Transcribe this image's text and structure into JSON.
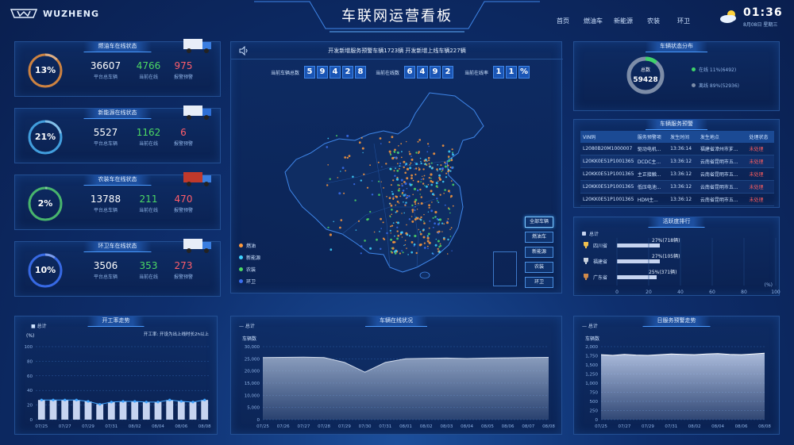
{
  "header": {
    "brand": "WUZHENG",
    "title": "车联网运营看板",
    "nav": [
      {
        "label": "首页",
        "active": true
      },
      {
        "label": "燃油车",
        "active": false
      },
      {
        "label": "新能源",
        "active": false
      },
      {
        "label": "农装",
        "active": false
      },
      {
        "label": "环卫",
        "active": false
      }
    ],
    "time": "01:36",
    "date": "8月08日 星期三",
    "weather_icon": "partly-cloudy-icon"
  },
  "vehicle_cards": [
    {
      "title": "燃油车在线状态",
      "percent": "13%",
      "ring_fraction": 0.13,
      "ring_color": "#e08a3a",
      "total": "36607",
      "total_label": "平台总车辆",
      "online": "4766",
      "online_label": "当前在线",
      "alarm": "975",
      "alarm_label": "报警预警",
      "icon": "truck-icon"
    },
    {
      "title": "新能源在线状态",
      "percent": "21%",
      "ring_fraction": 0.21,
      "ring_color": "#45a8e8",
      "total": "5527",
      "total_label": "平台总车辆",
      "online": "1162",
      "online_label": "当前在线",
      "alarm": "6",
      "alarm_label": "报警预警",
      "icon": "van-icon"
    },
    {
      "title": "农装车在线状态",
      "percent": "2%",
      "ring_fraction": 0.02,
      "ring_color": "#4cc26a",
      "total": "13788",
      "total_label": "平台总车辆",
      "online": "211",
      "online_label": "当前在线",
      "alarm": "470",
      "alarm_label": "报警预警",
      "icon": "tractor-icon"
    },
    {
      "title": "环卫车在线状态",
      "percent": "10%",
      "ring_fraction": 0.1,
      "ring_color": "#3a6ef0",
      "total": "3506",
      "total_label": "平台总车辆",
      "online": "353",
      "online_label": "当前在线",
      "alarm": "273",
      "alarm_label": "报警预警",
      "icon": "sanitation-truck-icon"
    }
  ],
  "center": {
    "notice": "开发新增服务预警车辆1723辆     开发新增上线车辆227辆",
    "kpis": [
      {
        "label": "当前车辆总数",
        "digits": [
          "5",
          "9",
          "4",
          "2",
          "8"
        ]
      },
      {
        "label": "当前在线数",
        "digits": [
          "6",
          "4",
          "9",
          "2"
        ]
      },
      {
        "label": "当前在线率",
        "digits": [
          "1",
          "1",
          "%"
        ]
      }
    ],
    "legend": [
      {
        "label": "燃油",
        "color": "#ff9a3c"
      },
      {
        "label": "新能源",
        "color": "#3fd3ff"
      },
      {
        "label": "农装",
        "color": "#4cd964"
      },
      {
        "label": "环卫",
        "color": "#3a6ef0"
      }
    ],
    "map_buttons": [
      {
        "label": "全部车辆",
        "active": true
      },
      {
        "label": "燃油车",
        "active": false
      },
      {
        "label": "新能源",
        "active": false
      },
      {
        "label": "农装",
        "active": false
      },
      {
        "label": "环卫",
        "active": false
      }
    ]
  },
  "status_dist": {
    "title": "车辆状态分布",
    "center_label": "总数",
    "center_value": "59428",
    "online_fraction": 0.11,
    "online": "在线 11%(6492)",
    "offline": "离线 89%(52936)"
  },
  "alarms": {
    "title": "车辆服务预警",
    "headers": [
      "VIN码",
      "服务预警项",
      "发生时间",
      "发生地点",
      "处理状态"
    ],
    "rows": [
      [
        "L2080B20M1000007",
        "驱动电机...",
        "13:36:14",
        "福建省漳州市芗...",
        "未处理"
      ],
      [
        "L20KK0E51P1001365",
        "DCDC主...",
        "13:36:12",
        "云南省昆明市五...",
        "未处理"
      ],
      [
        "L20KK0E51P1001365",
        "主正接触...",
        "13:36:12",
        "云南省昆明市五...",
        "未处理"
      ],
      [
        "L20KK0E51P1001365",
        "低压电池...",
        "13:36:12",
        "云南省昆明市五...",
        "未处理"
      ],
      [
        "L20KK0E51P1001365",
        "HDM主...",
        "13:36:12",
        "云南省昆明市五...",
        "未处理"
      ]
    ]
  },
  "ranking": {
    "title": "活跃度排行",
    "legend": "总计",
    "unit": "(%)",
    "axis": [
      "0",
      "20",
      "40",
      "60",
      "80",
      "100"
    ],
    "items": [
      {
        "name": "四川省",
        "value": 27,
        "label": "27%(718辆)",
        "icon": "gold-trophy-icon"
      },
      {
        "name": "福建省",
        "value": 27,
        "label": "27%(105辆)",
        "icon": "silver-trophy-icon"
      },
      {
        "name": "广东省",
        "value": 25,
        "label": "25%(371辆)",
        "icon": "bronze-trophy-icon"
      }
    ]
  },
  "online_trend": {
    "title": "开工率走势",
    "legend": "总计",
    "unit": "(%)",
    "note": "开工率: 开设为出上线时长2h以上",
    "chart_data": {
      "type": "bar",
      "categories": [
        "07/25",
        "07/26",
        "07/27",
        "07/28",
        "07/29",
        "07/30",
        "07/31",
        "08/01",
        "08/02",
        "08/03",
        "08/04",
        "08/05",
        "08/06",
        "08/07",
        "08/08"
      ],
      "values": [
        27,
        27,
        27,
        27,
        25,
        21,
        24,
        25,
        25,
        24,
        24,
        27,
        25,
        24,
        27
      ],
      "x_ticks": [
        "07/25",
        "07/27",
        "07/29",
        "07/31",
        "08/02",
        "08/04",
        "08/06",
        "08/08"
      ],
      "y_ticks": [
        "0",
        "20",
        "40",
        "60",
        "80",
        "100"
      ],
      "ylim": [
        0,
        100
      ]
    }
  },
  "online_status": {
    "title": "车辆在线状况",
    "legend": "总计",
    "ylabel": "车辆数",
    "chart_data": {
      "type": "area",
      "categories": [
        "07/25",
        "07/26",
        "07/27",
        "07/28",
        "07/29",
        "07/30",
        "07/31",
        "08/01",
        "08/02",
        "08/03",
        "08/04",
        "08/05",
        "08/06",
        "08/07",
        "08/08"
      ],
      "values": [
        25500,
        25600,
        25700,
        25500,
        23500,
        19500,
        23500,
        25000,
        25200,
        25300,
        25100,
        25300,
        25400,
        25500,
        25600
      ],
      "y_ticks": [
        "0",
        "5,000",
        "10,000",
        "15,000",
        "20,000",
        "25,000",
        "30,000"
      ],
      "ylim": [
        0,
        30000
      ]
    }
  },
  "service_trend": {
    "title": "日服务预警走势",
    "legend": "总计",
    "ylabel": "车辆数",
    "chart_data": {
      "type": "area",
      "categories": [
        "07/25",
        "07/26",
        "07/27",
        "07/28",
        "07/29",
        "07/30",
        "07/31",
        "08/01",
        "08/02",
        "08/03",
        "08/04",
        "08/05",
        "08/06",
        "08/07",
        "08/08"
      ],
      "values": [
        1780,
        1760,
        1790,
        1770,
        1760,
        1780,
        1800,
        1790,
        1780,
        1800,
        1810,
        1790,
        1780,
        1800,
        1820
      ],
      "x_ticks": [
        "07/25",
        "07/27",
        "07/29",
        "07/31",
        "08/02",
        "08/04",
        "08/06",
        "08/08"
      ],
      "y_ticks": [
        "0",
        "250",
        "500",
        "750",
        "1,000",
        "1,250",
        "1,500",
        "1,750",
        "2,000"
      ],
      "ylim": [
        0,
        2000
      ]
    }
  }
}
